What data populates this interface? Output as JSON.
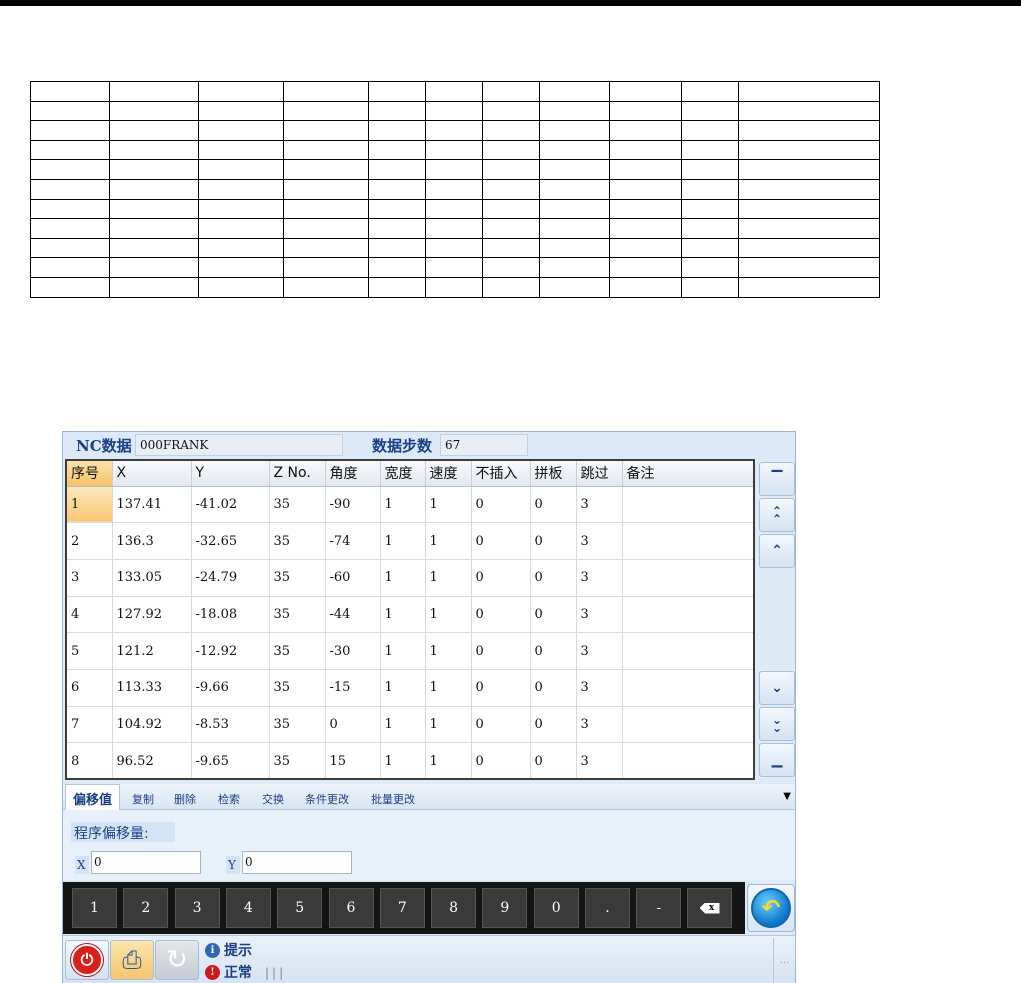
{
  "header": {
    "nc_label": "NC数据",
    "program_name": "000FRANK",
    "steps_label": "数据步数",
    "steps_value": "67"
  },
  "table": {
    "columns": [
      "序号",
      "X",
      "Y",
      "Z No.",
      "角度",
      "宽度",
      "速度",
      "不插入",
      "拼板",
      "跳过",
      "备注"
    ],
    "rows": [
      [
        "1",
        "137.41",
        "-41.02",
        "35",
        "-90",
        "1",
        "1",
        "0",
        "0",
        "3",
        ""
      ],
      [
        "2",
        "136.3",
        "-32.65",
        "35",
        "-74",
        "1",
        "1",
        "0",
        "0",
        "3",
        ""
      ],
      [
        "3",
        "133.05",
        "-24.79",
        "35",
        "-60",
        "1",
        "1",
        "0",
        "0",
        "3",
        ""
      ],
      [
        "4",
        "127.92",
        "-18.08",
        "35",
        "-44",
        "1",
        "1",
        "0",
        "0",
        "3",
        ""
      ],
      [
        "5",
        "121.2",
        "-12.92",
        "35",
        "-30",
        "1",
        "1",
        "0",
        "0",
        "3",
        ""
      ],
      [
        "6",
        "113.33",
        "-9.66",
        "35",
        "-15",
        "1",
        "1",
        "0",
        "0",
        "3",
        ""
      ],
      [
        "7",
        "104.92",
        "-8.53",
        "35",
        "0",
        "1",
        "1",
        "0",
        "0",
        "3",
        ""
      ],
      [
        "8",
        "96.52",
        "-9.65",
        "35",
        "15",
        "1",
        "1",
        "0",
        "0",
        "3",
        ""
      ]
    ],
    "selected_row": 0
  },
  "scroll": {
    "first_icon": "scroll-to-top-icon",
    "page_up_icon": "page-up-icon",
    "up_icon": "scroll-up-icon",
    "down_icon": "scroll-down-icon",
    "page_down_icon": "page-down-icon",
    "last_icon": "scroll-to-bottom-icon"
  },
  "tabs": [
    "偏移值",
    "复制",
    "删除",
    "检索",
    "交换",
    "条件更改",
    "批量更改"
  ],
  "active_tab": 0,
  "offset": {
    "label": "程序偏移量:",
    "x_label": "X",
    "x_value": "0",
    "y_label": "Y",
    "y_value": "0"
  },
  "keypad": {
    "keys": [
      "1",
      "2",
      "3",
      "4",
      "5",
      "6",
      "7",
      "8",
      "9",
      "0",
      ".",
      "-"
    ],
    "backspace_icon": "backspace-icon",
    "return_icon": "return-icon"
  },
  "status": {
    "hint_label": "提示",
    "status_label": "正常",
    "bars": "|||",
    "more": "···",
    "power_icon": "power-icon",
    "printer_icon": "printer-icon",
    "refresh_icon": "refresh-icon"
  },
  "colors": {
    "accent": "#1b3f87",
    "window_bg": "#dfeaf7",
    "selected_row": "#f8c674",
    "keypad_bg": "#141414"
  }
}
